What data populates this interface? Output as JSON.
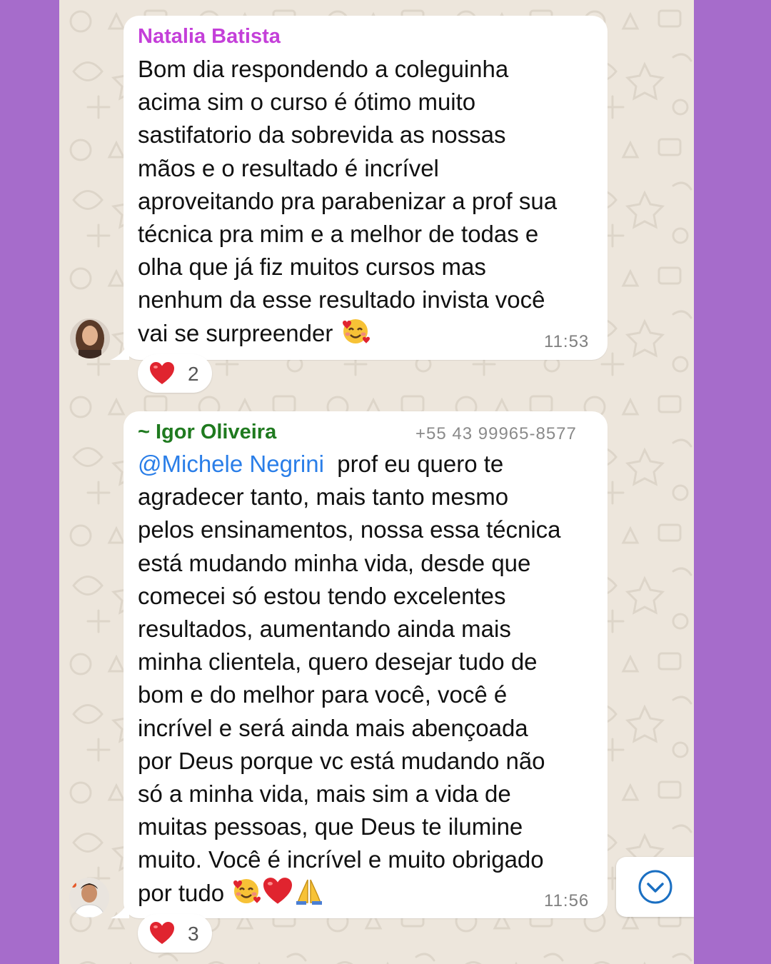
{
  "messages": [
    {
      "sender": "Natalia Batista",
      "sender_color": "#c43fd9",
      "lines": [
        "Bom dia respondendo a coleguinha",
        "acima sim o curso é ótimo muito",
        "sastifatorio da sobrevida as nossas",
        "mãos e o resultado é incrível",
        "aproveitando pra parabenizar a prof sua",
        "técnica pra mim e a melhor de todas e",
        "olha que já fiz muitos cursos mas",
        "nenhum da esse resultado invista você",
        "vai se surpreender"
      ],
      "end_emoji": [
        "smiling-face-with-hearts-icon"
      ],
      "time": "11:53",
      "reaction": {
        "icon": "heart-icon",
        "count": "2"
      }
    },
    {
      "sender": "~ Igor Oliveira",
      "sender_color": "#1f7a1f",
      "phone": "+55 43 99965-8577",
      "mention": "@Michele Negrini",
      "first_line_rest": "prof eu quero te",
      "lines": [
        "agradecer tanto, mais tanto mesmo",
        "pelos ensinamentos, nossa essa técnica",
        "está mudando minha vida, desde que",
        "comecei só estou tendo excelentes",
        "resultados, aumentando ainda mais",
        "minha clientela, quero desejar tudo de",
        "bom e do melhor para você, você é",
        "incrível e será ainda mais abençoada",
        "por Deus porque vc está mudando não",
        "só a minha vida, mais sim a vida de",
        "muitas pessoas, que Deus te ilumine",
        "muito. Você é incrível e muito obrigado",
        "por tudo"
      ],
      "end_emoji": [
        "smiling-face-with-hearts-icon",
        "red-heart-icon",
        "folded-hands-icon"
      ],
      "time": "11:56",
      "reaction": {
        "icon": "heart-icon",
        "count": "3"
      }
    }
  ],
  "scroll_button": {
    "icon": "chevron-down-circle-icon"
  },
  "colors": {
    "background": "#a66ccb",
    "chat_bg": "#ede6dc",
    "mention": "#2a7ee8",
    "heart": "#e0242f"
  }
}
